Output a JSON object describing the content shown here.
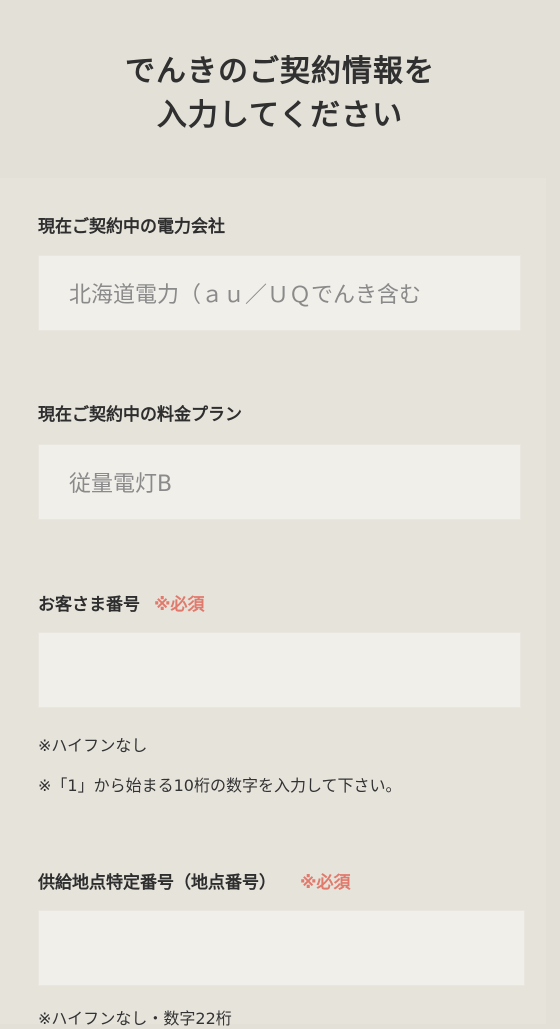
{
  "header": {
    "title_line1": "でんきのご契約情報を",
    "title_line2": "入力してください"
  },
  "fields": {
    "current_company": {
      "label": "現在ご契約中の電力会社",
      "value": "北海道電力（ａｕ／ＵＱでんき含む"
    },
    "current_plan": {
      "label": "現在ご契約中の料金プラン",
      "value": "従量電灯B"
    },
    "customer_number": {
      "label": "お客さま番号",
      "required": "※必須",
      "value": "",
      "note1": "※ハイフンなし",
      "note2": "※「1」から始まる10桁の数字を入力して下さい。"
    },
    "supply_point": {
      "label": "供給地点特定番号（地点番号）",
      "required": "※必須",
      "value": "",
      "note1": "※ハイフンなし・数字22桁"
    }
  },
  "colors": {
    "background": "#e3e0d7",
    "panel": "#e6e3db",
    "input": "#f1efea",
    "required": "#e07a6c"
  }
}
